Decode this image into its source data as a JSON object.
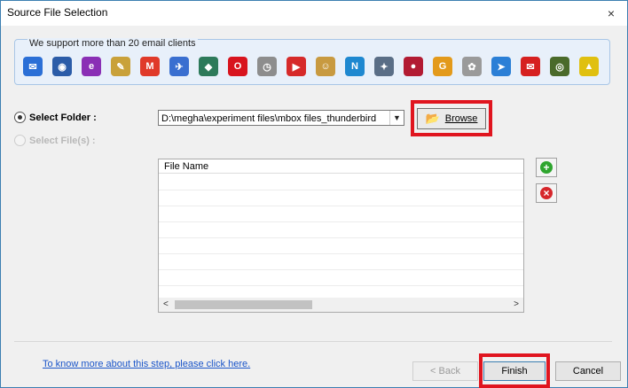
{
  "window": {
    "title": "Source File Selection",
    "close_glyph": "×"
  },
  "clients": {
    "label": "We support more than 20 email clients",
    "icons": [
      {
        "name": "windows-mail-icon",
        "glyph": "✉",
        "color": "#2b6fd6"
      },
      {
        "name": "thunderbird-icon",
        "glyph": "◉",
        "color": "#2b5ca8"
      },
      {
        "name": "entourage-icon",
        "glyph": "e",
        "color": "#8a2fb5"
      },
      {
        "name": "pegasus-icon",
        "glyph": "✎",
        "color": "#c9a13a"
      },
      {
        "name": "gmail-icon",
        "glyph": "M",
        "color": "#e03a2a"
      },
      {
        "name": "postbox-icon",
        "glyph": "✈",
        "color": "#3a6fd0"
      },
      {
        "name": "seamonkey-icon",
        "glyph": "◆",
        "color": "#2d7a5a"
      },
      {
        "name": "opera-mail-icon",
        "glyph": "O",
        "color": "#d8141e"
      },
      {
        "name": "mailcopa-icon",
        "glyph": "◷",
        "color": "#8d8d8d"
      },
      {
        "name": "powermail-icon",
        "glyph": "▶",
        "color": "#d62a2a"
      },
      {
        "name": "eudora-icon",
        "glyph": "☺",
        "color": "#c89a40"
      },
      {
        "name": "netscape-icon",
        "glyph": "N",
        "color": "#1e88d0"
      },
      {
        "name": "spicebird-icon",
        "glyph": "✦",
        "color": "#5a6e86"
      },
      {
        "name": "mulberry-icon",
        "glyph": "●",
        "color": "#b21b33"
      },
      {
        "name": "gyazmail-icon",
        "glyph": "G",
        "color": "#e39a1b"
      },
      {
        "name": "claws-mail-icon",
        "glyph": "✿",
        "color": "#9a9a9a"
      },
      {
        "name": "sylpheed-icon",
        "glyph": "➤",
        "color": "#2b7fd6"
      },
      {
        "name": "mail-icon",
        "glyph": "✉",
        "color": "#d62020"
      },
      {
        "name": "evolution-icon",
        "glyph": "◎",
        "color": "#4a6a2a"
      },
      {
        "name": "the-bat-icon",
        "glyph": "▲",
        "color": "#e0c010"
      }
    ]
  },
  "select_folder": {
    "label": "Select Folder :",
    "path_value": "D:\\megha\\experiment files\\mbox files_thunderbird",
    "dropdown_glyph": "▼"
  },
  "browse": {
    "label": "Browse",
    "icon_glyph": "📂"
  },
  "select_files": {
    "label": "Select File(s) :"
  },
  "file_table": {
    "column_header": "File Name",
    "scroll_left": "<",
    "scroll_right": ">"
  },
  "side_buttons": {
    "add_glyph": "+",
    "remove_glyph": "×"
  },
  "footer": {
    "help_link": "To know more about this step, please click here.",
    "back_label": "< Back",
    "finish_label": "Finish",
    "cancel_label": "Cancel"
  }
}
